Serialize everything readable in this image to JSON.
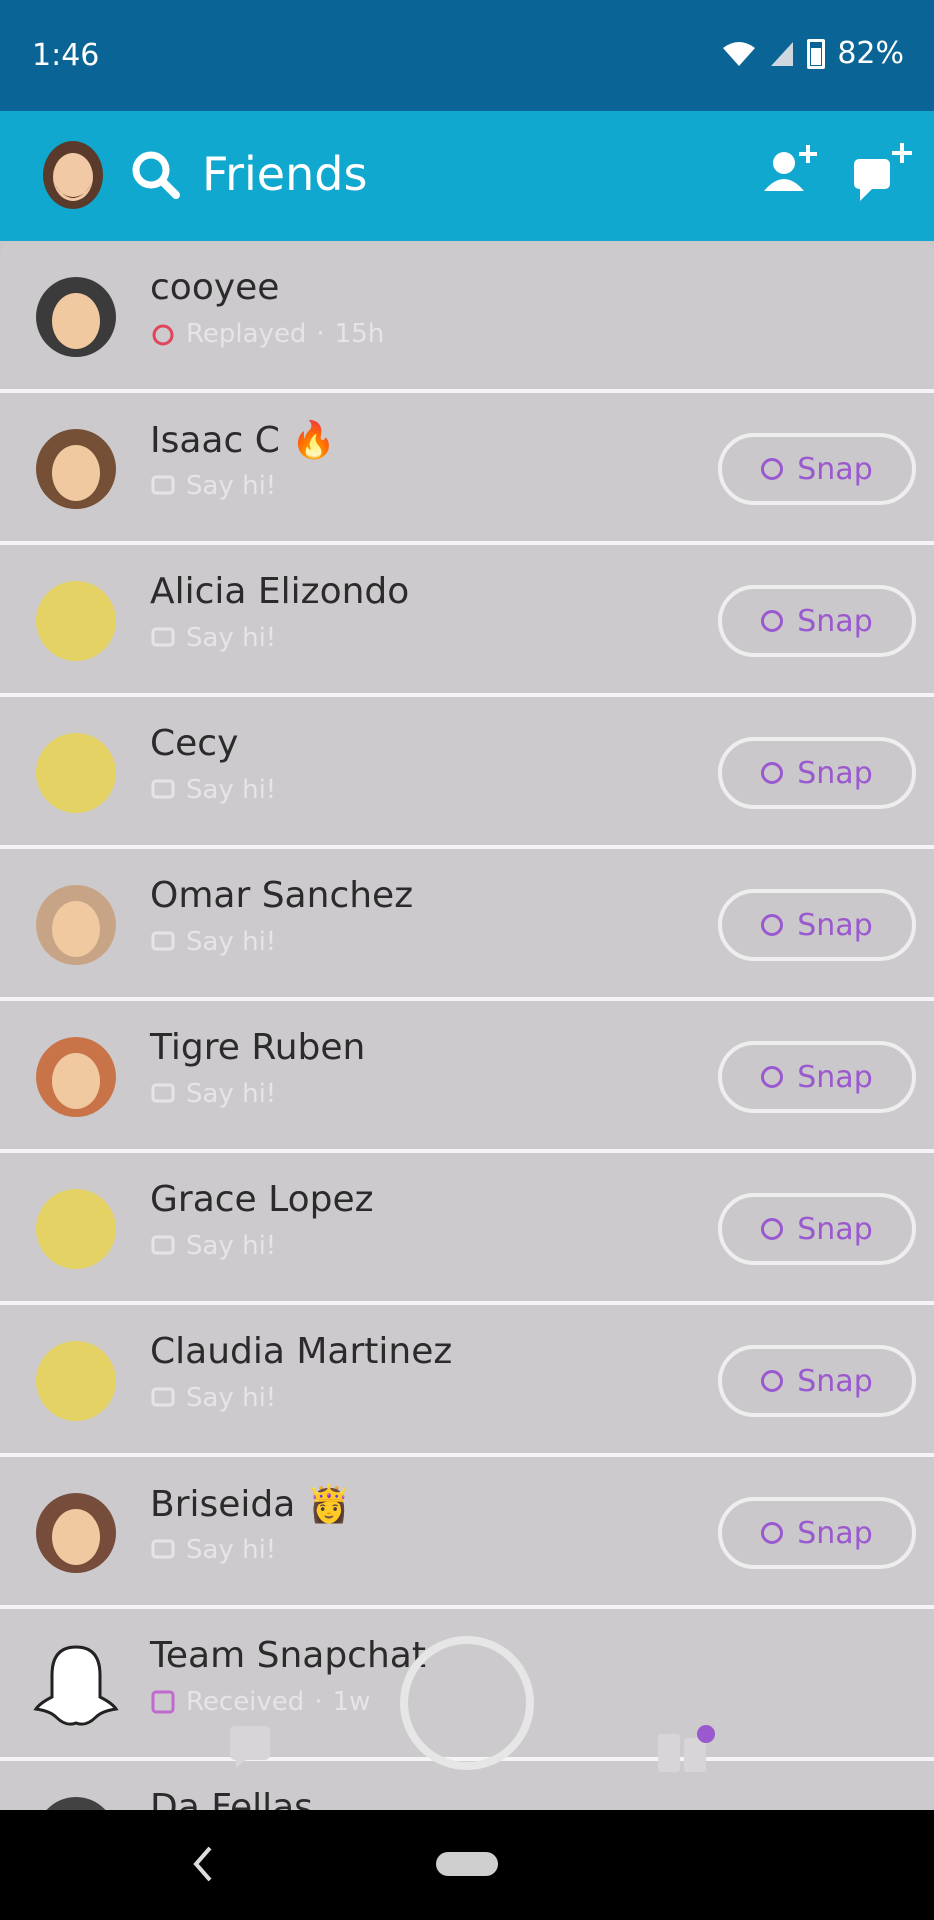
{
  "status": {
    "time": "1:46",
    "battery": "82%"
  },
  "header": {
    "title": "Friends"
  },
  "colors": {
    "accent_header": "#11a8d0",
    "status_bar": "#0a6596",
    "snap_purple": "#9b59d0",
    "replayed_red": "#e0455b"
  },
  "icons": {
    "status": [
      "wifi-icon",
      "signal-icon",
      "battery-icon"
    ],
    "header": [
      "profile-avatar",
      "search-icon",
      "add-friend-icon",
      "new-chat-icon"
    ],
    "bottom": [
      "capture-button",
      "chat-tab-icon",
      "discover-tab-icon"
    ]
  },
  "friends": [
    {
      "name": "cooyee",
      "status": "Replayed",
      "time": "15h",
      "status_icon": "replay-icon",
      "snap_button": false
    },
    {
      "name": "Isaac C",
      "emoji": "🔥",
      "status": "Say hi!",
      "time": "",
      "status_icon": "chat-icon",
      "snap_button": true,
      "snap_label": "Snap"
    },
    {
      "name": "Alicia Elizondo",
      "status": "Say hi!",
      "time": "",
      "status_icon": "chat-icon",
      "snap_button": true,
      "snap_label": "Snap"
    },
    {
      "name": "Cecy",
      "status": "Say hi!",
      "time": "",
      "status_icon": "chat-icon",
      "snap_button": true,
      "snap_label": "Snap"
    },
    {
      "name": "Omar Sanchez",
      "status": "Say hi!",
      "time": "",
      "status_icon": "chat-icon",
      "snap_button": true,
      "snap_label": "Snap"
    },
    {
      "name": "Tigre Ruben",
      "status": "Say hi!",
      "time": "",
      "status_icon": "chat-icon",
      "snap_button": true,
      "snap_label": "Snap"
    },
    {
      "name": "Grace Lopez",
      "status": "Say hi!",
      "time": "",
      "status_icon": "chat-icon",
      "snap_button": true,
      "snap_label": "Snap"
    },
    {
      "name": "Claudia Martinez",
      "status": "Say hi!",
      "time": "",
      "status_icon": "chat-icon",
      "snap_button": true,
      "snap_label": "Snap"
    },
    {
      "name": "Briseida",
      "emoji": "👸",
      "status": "Say hi!",
      "time": "",
      "status_icon": "chat-icon",
      "snap_button": true,
      "snap_label": "Snap"
    },
    {
      "name": "Team Snapchat",
      "status": "Received",
      "time": "1w",
      "status_icon": "received-icon",
      "snap_button": false
    },
    {
      "name": "Da Fellas",
      "status": "",
      "time": "",
      "status_icon": "",
      "snap_button": false
    }
  ]
}
